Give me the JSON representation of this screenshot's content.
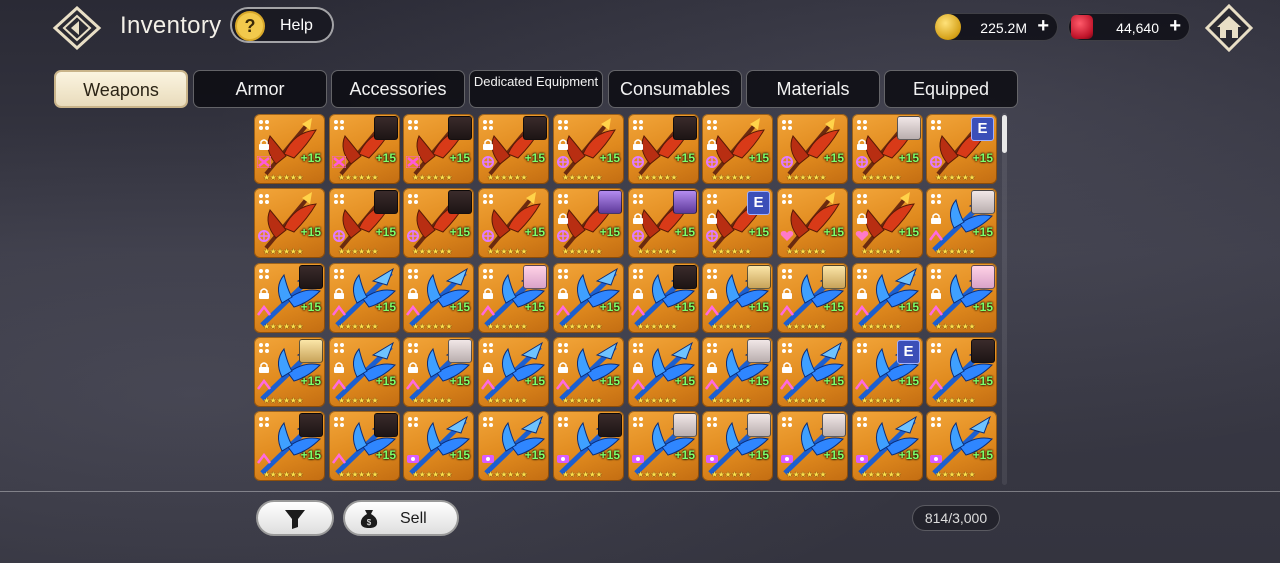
{
  "header": {
    "title": "Inventory",
    "help_label": "Help",
    "help_icon": "question-icon",
    "gold": {
      "icon": "gold-coin-icon",
      "value": "225.2M",
      "plus": "+"
    },
    "gems": {
      "icon": "red-gem-icon",
      "value": "44,640",
      "plus": "+"
    },
    "home_icon": "home-icon",
    "back_icon": "back-diamond-icon"
  },
  "tabs": [
    {
      "label": "Weapons",
      "active": true
    },
    {
      "label": "Armor",
      "active": false
    },
    {
      "label": "Accessories",
      "active": false
    },
    {
      "label": "Dedicated Equipment",
      "active": false
    },
    {
      "label": "Consumables",
      "active": false
    },
    {
      "label": "Materials",
      "active": false
    },
    {
      "label": "Equipped",
      "active": false
    }
  ],
  "item_common": {
    "enhance": "+15",
    "stars": "★★★★★★"
  },
  "items": [
    [
      "axe",
      "none",
      "",
      "lock",
      "bow"
    ],
    [
      "axe",
      "dark",
      "",
      "",
      "bow"
    ],
    [
      "axe",
      "dark",
      "",
      "",
      "bow"
    ],
    [
      "axe",
      "dark",
      "",
      "lock",
      "target"
    ],
    [
      "axe",
      "none",
      "",
      "lock",
      "target"
    ],
    [
      "axe",
      "dark",
      "",
      "lock",
      "target"
    ],
    [
      "axe",
      "none",
      "",
      "lock",
      "target"
    ],
    [
      "axe",
      "none",
      "",
      "",
      "target"
    ],
    [
      "axe",
      "light",
      "",
      "lock",
      "target"
    ],
    [
      "axe",
      "none",
      "E",
      "",
      "target"
    ],
    [
      "axe",
      "none",
      "",
      "",
      "target"
    ],
    [
      "axe",
      "dark",
      "",
      "",
      "target"
    ],
    [
      "axe",
      "dark",
      "",
      "",
      "target"
    ],
    [
      "axe",
      "none",
      "",
      "",
      "target"
    ],
    [
      "axe",
      "purple",
      "",
      "lock",
      "target"
    ],
    [
      "axe",
      "purple",
      "",
      "lock",
      "target"
    ],
    [
      "axe",
      "none",
      "E",
      "lock",
      "target"
    ],
    [
      "axe",
      "none",
      "",
      "",
      "heart"
    ],
    [
      "axe",
      "none",
      "",
      "lock",
      "heart"
    ],
    [
      "spear",
      "light",
      "",
      "lock",
      "cross"
    ],
    [
      "spear",
      "dark",
      "",
      "lock",
      "cross"
    ],
    [
      "spear",
      "none",
      "",
      "lock",
      "cross"
    ],
    [
      "spear",
      "none",
      "",
      "lock",
      "cross"
    ],
    [
      "spear",
      "pink",
      "",
      "lock",
      "cross"
    ],
    [
      "spear",
      "none",
      "",
      "lock",
      "cross"
    ],
    [
      "spear",
      "dark",
      "",
      "lock",
      "cross"
    ],
    [
      "spear",
      "blond",
      "",
      "lock",
      "cross"
    ],
    [
      "spear",
      "blond",
      "",
      "lock",
      "cross"
    ],
    [
      "spear",
      "none",
      "",
      "lock",
      "cross"
    ],
    [
      "spear",
      "pink",
      "",
      "lock",
      "cross"
    ],
    [
      "spear",
      "blond",
      "",
      "lock",
      "cross"
    ],
    [
      "spear",
      "none",
      "",
      "lock",
      "cross"
    ],
    [
      "spear",
      "light",
      "",
      "lock",
      "cross"
    ],
    [
      "spear",
      "none",
      "",
      "lock",
      "cross"
    ],
    [
      "spear",
      "none",
      "",
      "lock",
      "cross"
    ],
    [
      "spear",
      "none",
      "",
      "lock",
      "cross"
    ],
    [
      "spear",
      "light",
      "",
      "lock",
      "cross"
    ],
    [
      "spear",
      "none",
      "",
      "lock",
      "cross"
    ],
    [
      "spear",
      "none",
      "E",
      "",
      "cross"
    ],
    [
      "spear",
      "dark",
      "",
      "",
      "cross"
    ],
    [
      "spear",
      "dark",
      "",
      "",
      "cross"
    ],
    [
      "spear",
      "dark",
      "",
      "",
      "cross"
    ],
    [
      "spear",
      "none",
      "",
      "",
      "magic"
    ],
    [
      "spear",
      "none",
      "",
      "",
      "magic"
    ],
    [
      "spear",
      "dark",
      "",
      "",
      "magic"
    ],
    [
      "spear",
      "light",
      "",
      "",
      "magic"
    ],
    [
      "spear",
      "light",
      "",
      "",
      "magic"
    ],
    [
      "spear",
      "light",
      "",
      "",
      "magic"
    ],
    [
      "spear",
      "none",
      "",
      "",
      "magic"
    ],
    [
      "spear",
      "none",
      "",
      "",
      "magic"
    ]
  ],
  "bottom": {
    "filter_icon": "filter-icon",
    "sell_icon": "money-bag-icon",
    "sell_label": "Sell",
    "capacity": "814/3,000"
  }
}
